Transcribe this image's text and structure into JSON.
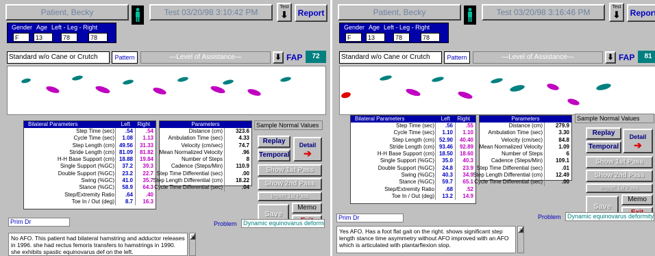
{
  "panels": [
    {
      "patient": "Patient, Becky",
      "test": "Test 03/20/98 3:10:42 PM",
      "test_btn": "Test",
      "report": "Report",
      "demo_labels": {
        "gender": "Gender",
        "age": "Age",
        "legs": "Left - Leg - Right"
      },
      "gender": "F",
      "age": "13",
      "left_leg": "78",
      "right_leg": "78",
      "condition": "Standard w/o Cane or Crutch",
      "pattern": "Pattern",
      "level": "Level of Assistance",
      "fap_label": "FAP",
      "fap": "72",
      "bilateral_header": {
        "title": "Bilateral Parameters",
        "left": "Left",
        "right": "Right"
      },
      "bilateral": [
        {
          "label": "Step Time (sec)",
          "left": ".54",
          "right": ".54"
        },
        {
          "label": "Cycle Time (sec)",
          "left": "1.08",
          "right": "1.13"
        },
        {
          "label": "Step Length (cm)",
          "left": "49.56",
          "right": "31.33"
        },
        {
          "label": "Stride Length (cm)",
          "left": "81.09",
          "right": "81.82"
        },
        {
          "label": "H-H Base Support (cm)",
          "left": "18.88",
          "right": "19.84"
        },
        {
          "label": "Single Support (%GC)",
          "left": "37.2",
          "right": "39.3"
        },
        {
          "label": "Double Support (%GC)",
          "left": "23.2",
          "right": "22.7"
        },
        {
          "label": "Swing (%GC)",
          "left": "41.0",
          "right": "35.7"
        },
        {
          "label": "Stance (%GC)",
          "left": "58.9",
          "right": "64.3"
        },
        {
          "label": "Step/Extremity Ratio",
          "left": ".64",
          "right": ".40"
        },
        {
          "label": "Toe In / Out (deg)",
          "left": "8.7",
          "right": "16.3"
        }
      ],
      "params_header": "Parameters",
      "params": [
        {
          "label": "Distance (cm)",
          "value": "323.6"
        },
        {
          "label": "Ambulation Time (sec)",
          "value": "4.33"
        },
        {
          "label": "Velocity (cm/sec)",
          "value": "74.7"
        },
        {
          "label": "Mean Normalized Velocity",
          "value": ".96"
        },
        {
          "label": "Number of Steps",
          "value": "8"
        },
        {
          "label": "Cadence (Steps/Min)",
          "value": "110.9"
        },
        {
          "label": "Step Time Differential (sec)",
          "value": ".00"
        },
        {
          "label": "Step Length Differential (cm)",
          "value": "18.22"
        },
        {
          "label": "Cycle Time Differential (sec)",
          "value": ".04"
        }
      ],
      "sample": "Sample Normal Values",
      "buttons": {
        "replay": "Replay",
        "temporal": "Temporal",
        "detail": "Detail",
        "show1": "Show 1st Pass",
        "show2": "Show 2nd Pass",
        "import1": "Import 1st Pass",
        "save": "Save",
        "memo": "Memo",
        "exit": "Exit"
      },
      "prim_dr": "Prim Dr",
      "problem_label": "Problem",
      "problem": "Dynamic equinovarus deformity, managed",
      "notes": "No AFO. This patient had bilateral hamstring and adductor releases in 1996. she had rectus femoris transfers to hamstrings in 1990. she exhibits spastic equinovarus def on the left."
    },
    {
      "patient": "Patient, Becky",
      "test": "Test 03/20/98 3:16:46 PM",
      "test_btn": "Test",
      "report": "Report",
      "demo_labels": {
        "gender": "Gender",
        "age": "Age",
        "legs": "Left - Leg - Right"
      },
      "gender": "F",
      "age": "13",
      "left_leg": "78",
      "right_leg": "78",
      "condition": "Standard w/o Cane or Crutch",
      "pattern": "Pattern",
      "level": "Level of Assistance",
      "fap_label": "FAP",
      "fap": "81",
      "bilateral_header": {
        "title": "Bilateral Parameters",
        "left": "Left",
        "right": "Right"
      },
      "bilateral": [
        {
          "label": "Step Time (sec)",
          "left": ".56",
          "right": ".55"
        },
        {
          "label": "Cycle Time (sec)",
          "left": "1.10",
          "right": "1.10"
        },
        {
          "label": "Step Length (cm)",
          "left": "52.90",
          "right": "40.40"
        },
        {
          "label": "Stride Length (cm)",
          "left": "93.46",
          "right": "92.89"
        },
        {
          "label": "H-H Base Support (cm)",
          "left": "18.50",
          "right": "18.60"
        },
        {
          "label": "Single Support (%GC)",
          "left": "35.0",
          "right": "40.3"
        },
        {
          "label": "Double Support (%GC)",
          "left": "24.8",
          "right": "23.9"
        },
        {
          "label": "Swing (%GC)",
          "left": "40.3",
          "right": "34.9"
        },
        {
          "label": "Stance (%GC)",
          "left": "59.7",
          "right": "65.1"
        },
        {
          "label": "Step/Extremity Ratio",
          "left": ".68",
          "right": ".52"
        },
        {
          "label": "Toe In / Out (deg)",
          "left": "13.2",
          "right": "14.9"
        }
      ],
      "params_header": "Parameters",
      "params": [
        {
          "label": "Distance (cm)",
          "value": "279.9"
        },
        {
          "label": "Ambulation Time (sec)",
          "value": "3.30"
        },
        {
          "label": "Velocity (cm/sec)",
          "value": "84.8"
        },
        {
          "label": "Mean Normalized Velocity",
          "value": "1.09"
        },
        {
          "label": "Number of Steps",
          "value": "6"
        },
        {
          "label": "Cadence (Steps/Min)",
          "value": "109.1"
        },
        {
          "label": "Step Time Differential (sec)",
          "value": ".01"
        },
        {
          "label": "Step Length Differential (cm)",
          "value": "12.49"
        },
        {
          "label": "Cycle Time Differential (sec)",
          "value": ".00"
        }
      ],
      "sample": "Sample Normal Values",
      "buttons": {
        "replay": "Replay",
        "temporal": "Temporal",
        "detail": "Detail",
        "show1": "Show 1st Pass",
        "show2": "Show 2nd Pass",
        "import1": "Import 1st Pass",
        "save": "Save",
        "memo": "Memo",
        "exit": "Exit"
      },
      "prim_dr": "Prim Dr",
      "problem_label": "Problem",
      "problem": "Dynamic equinovarus deformity, managed",
      "notes": "Yes AFO. Has a foot flat gait on the right. shows significant step length stance time asymmetry without AFO improved with an AFO which is articulated with plantarflexion stop."
    }
  ],
  "colors": {
    "left_foot": "#008080",
    "right_foot": "#c000c0",
    "red_foot": "#e00000",
    "header_blue": "#0000a8"
  }
}
